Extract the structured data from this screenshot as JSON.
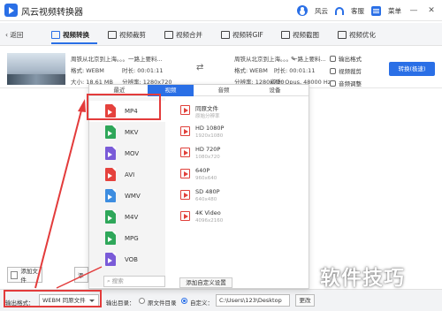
{
  "app": {
    "title": "风云视频转换器"
  },
  "titlebar": {
    "user_label": "风云",
    "service_label": "客服",
    "menu_label": "菜单",
    "minimize": "—",
    "close": "✕"
  },
  "toolbar": {
    "back_label": "返回",
    "tabs": [
      {
        "label": "视频转换",
        "icon": "video-convert-icon"
      },
      {
        "label": "视频裁剪",
        "icon": "video-crop-icon"
      },
      {
        "label": "视频合并",
        "icon": "video-merge-icon"
      },
      {
        "label": "视频转GIF",
        "icon": "video-gif-icon"
      },
      {
        "label": "视频截图",
        "icon": "video-screenshot-icon"
      },
      {
        "label": "视频优化",
        "icon": "video-optimize-icon"
      }
    ],
    "active_tab": 0
  },
  "file": {
    "src_name": "周铁从北京到上海。。。一路上要料...",
    "src_format": "格式: WEBM",
    "src_duration": "时长: 00:01:11",
    "src_size": "大小: 18.61 MB",
    "src_resolution": "分辨率: 1280x720",
    "dst_name": "周铁从北京到上海。。。一路上要料...",
    "dst_format": "格式: WEBM",
    "dst_resolution": "分辨率: 1280x720",
    "dst_duration": "时长: 00:01:11",
    "dst_audio": "音质: Opus, 48000 Hz",
    "actions": [
      "输出格式",
      "视频裁剪",
      "音频调整"
    ],
    "convert_button": "转换(极速)"
  },
  "format_panel": {
    "tabs": [
      "最近",
      "视频",
      "音频",
      "设备"
    ],
    "active_tab": 1,
    "formats": [
      "MP4",
      "MKV",
      "MOV",
      "AVI",
      "WMV",
      "M4V",
      "MPG",
      "VOB"
    ],
    "format_colors": [
      "#e5423d",
      "#2fa75a",
      "#7a5bd8",
      "#e5423d",
      "#3d8de0",
      "#2fa75a",
      "#2fa75a",
      "#7a5bd8"
    ],
    "selected_format": 0,
    "search_placeholder": "搜索",
    "resolutions": [
      {
        "name": "同原文件",
        "sub": "原始分辨率"
      },
      {
        "name": "HD 1080P",
        "sub": "1920x1080"
      },
      {
        "name": "HD 720P",
        "sub": "1080x720"
      },
      {
        "name": "640P",
        "sub": "960x640"
      },
      {
        "name": "SD 480P",
        "sub": "640x480"
      },
      {
        "name": "4K Video",
        "sub": "4096x2160"
      }
    ],
    "add_custom": "添加自定义设置"
  },
  "bottom": {
    "add_file": "添加文件",
    "add_folder": "添"
  },
  "statusbar": {
    "output_format_label": "输出格式：",
    "output_format_value": "WEBM 同原文件",
    "output_dir_label": "输出目录：",
    "source_dir_label": "原文件目录",
    "custom_label": "自定义：",
    "path": "C:\\Users\\123\\Desktop",
    "change": "更改"
  },
  "watermark": "软件技巧",
  "accent_color": "#2a6fe6",
  "highlight_color": "#e33b3b"
}
